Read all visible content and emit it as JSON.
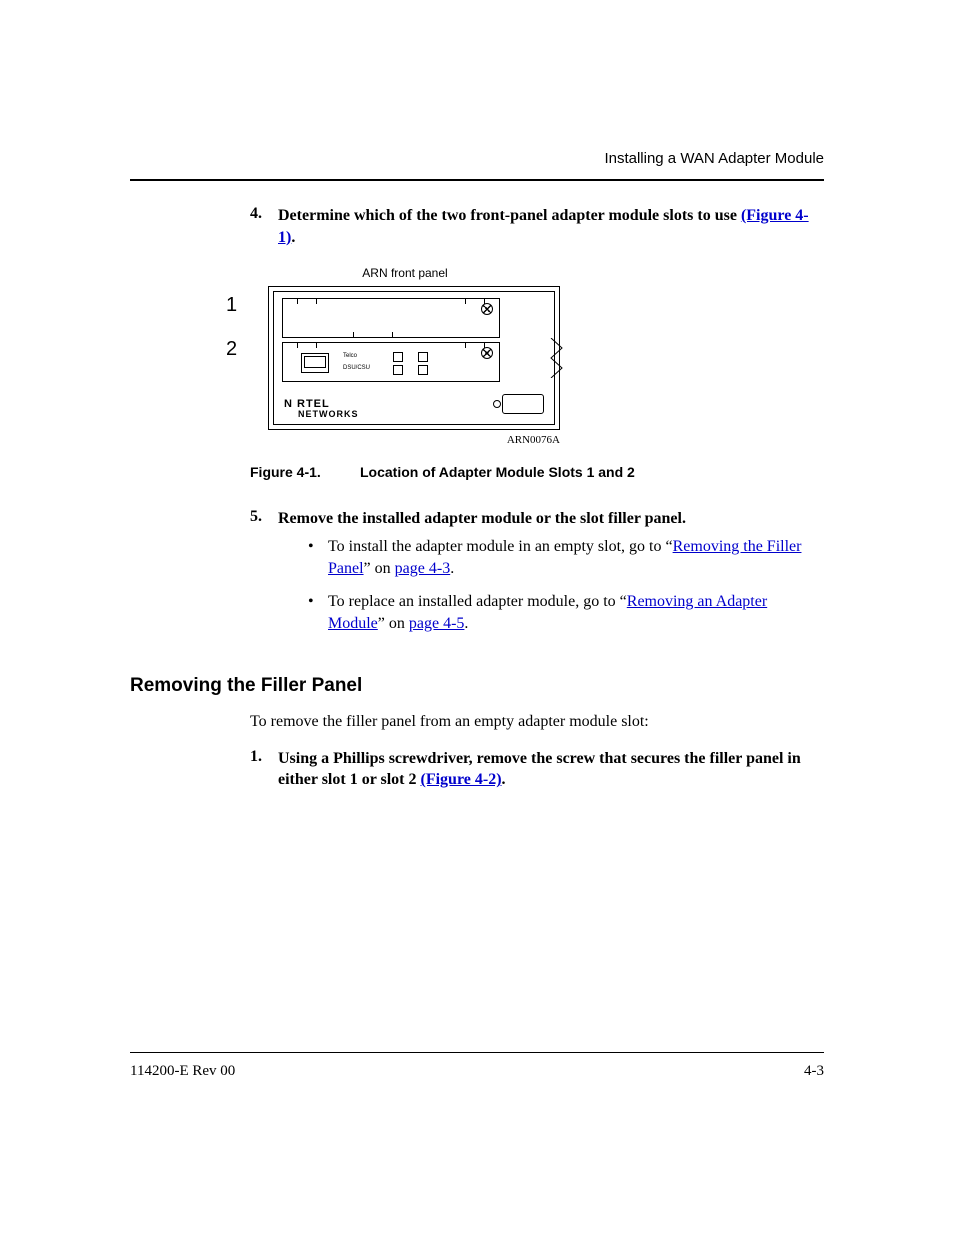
{
  "header": {
    "running_title": "Installing a WAN Adapter Module"
  },
  "step4": {
    "number": "4.",
    "text_before_link": "Determine which of the two front-panel adapter module slots to use ",
    "link": "(Figure 4-1)",
    "text_after_link": "."
  },
  "figure": {
    "top_label": "ARN front panel",
    "slot1": "1",
    "slot2": "2",
    "telco": "Telco",
    "dsu": "DSU/CSU",
    "brand_line1": "N   RTEL",
    "brand_line2": "NETWORKS",
    "code": "ARN0076A",
    "caption_label": "Figure 4-1.",
    "caption_text": "Location of Adapter Module Slots 1 and 2"
  },
  "step5": {
    "number": "5.",
    "text": "Remove the installed adapter module or the slot filler panel.",
    "bullets": [
      {
        "pre": "To install the adapter module in an empty slot, go to “",
        "link": "Removing the Filler Panel",
        "mid": "” on ",
        "pagelink": "page 4-3",
        "post": "."
      },
      {
        "pre": "To replace an installed adapter module, go to “",
        "link": "Removing an Adapter Module",
        "mid": "” on ",
        "pagelink": "page 4-5",
        "post": "."
      }
    ]
  },
  "section": {
    "heading": "Removing the Filler Panel",
    "intro": "To remove the filler panel from an empty adapter module slot:",
    "step1": {
      "number": "1.",
      "text_before": "Using a Phillips screwdriver, remove the screw that secures the filler panel in either slot 1 or slot 2 ",
      "link": "(Figure 4-2)",
      "text_after": "."
    }
  },
  "footer": {
    "left": "114200-E Rev 00",
    "right": "4-3"
  }
}
